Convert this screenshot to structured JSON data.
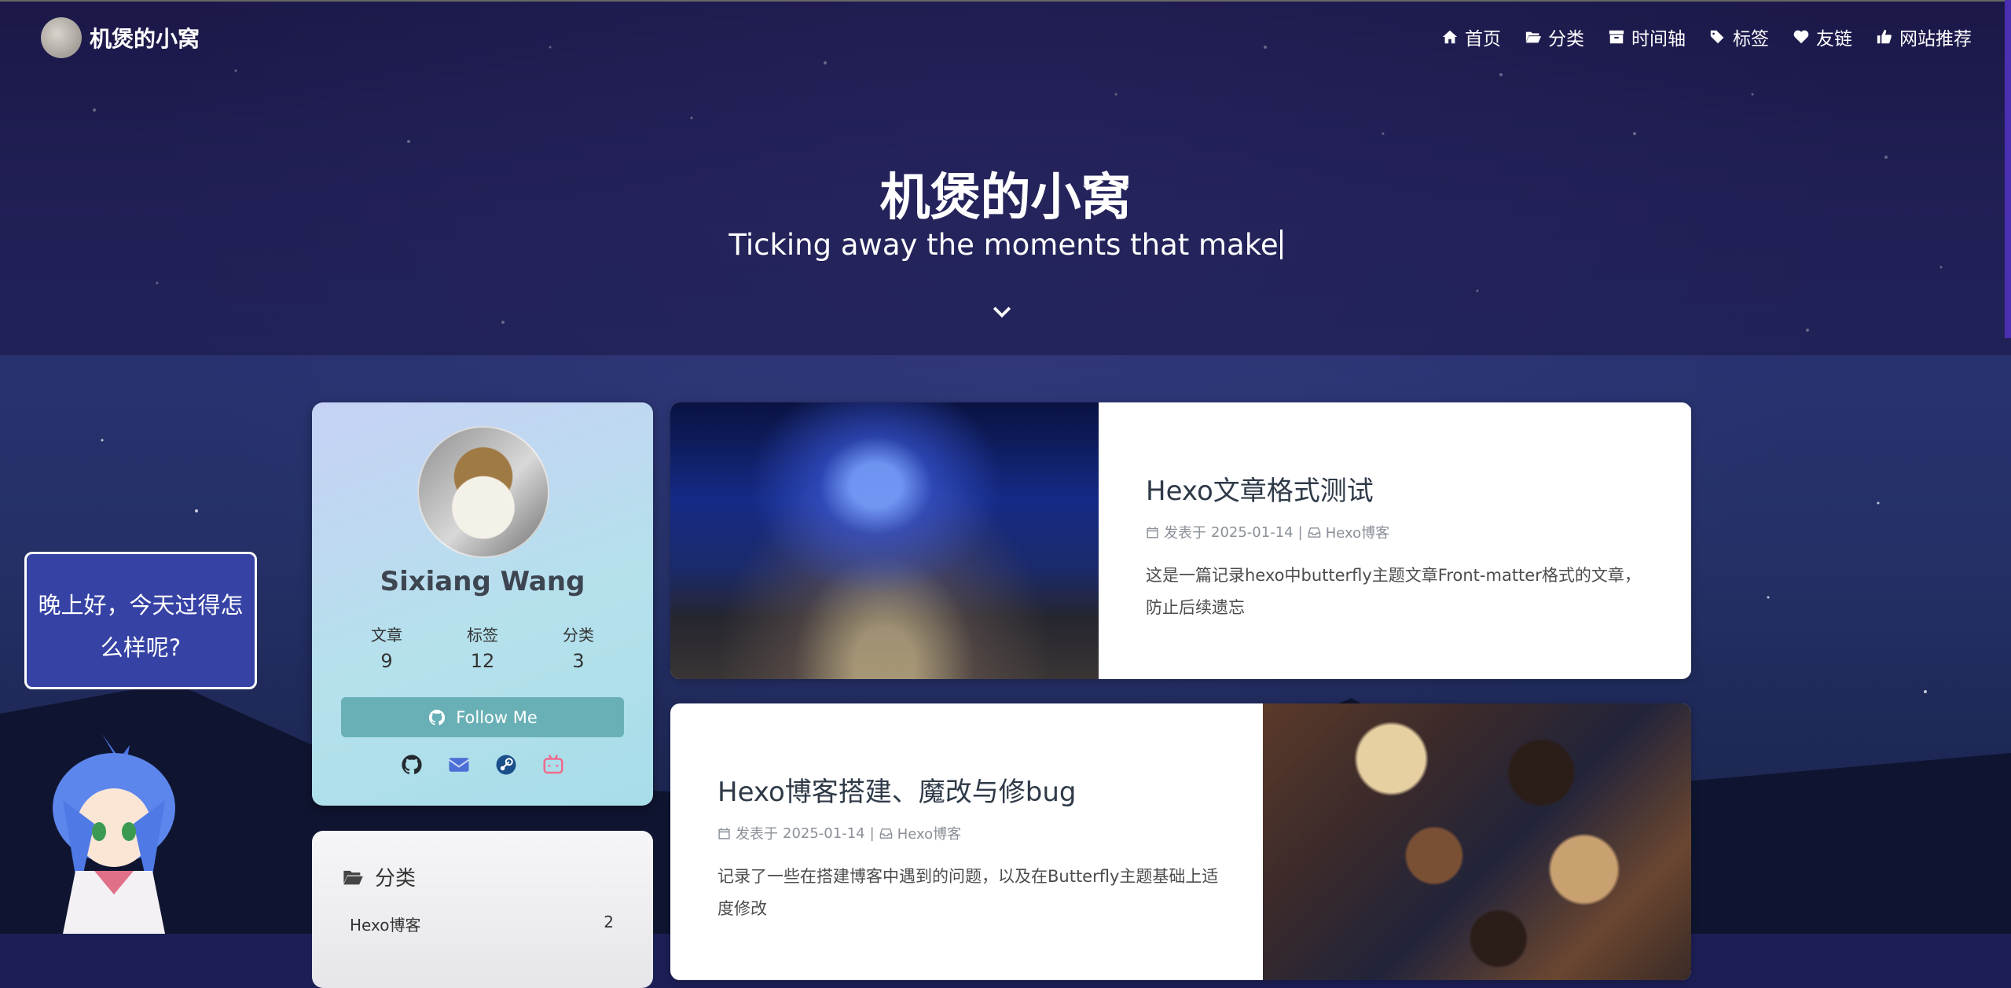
{
  "site": {
    "logo_text": "机煲的小窝",
    "title": "机煲的小窝",
    "subtitle": "Ticking away the moments that make"
  },
  "nav": [
    {
      "label": "首页",
      "icon": "home-icon"
    },
    {
      "label": "分类",
      "icon": "folder-open-icon"
    },
    {
      "label": "时间轴",
      "icon": "archive-icon"
    },
    {
      "label": "标签",
      "icon": "tags-icon"
    },
    {
      "label": "友链",
      "icon": "heart-icon"
    },
    {
      "label": "网站推荐",
      "icon": "thumbs-up-icon"
    }
  ],
  "profile": {
    "name": "Sixiang Wang",
    "stats": [
      {
        "label": "文章",
        "value": "9"
      },
      {
        "label": "标签",
        "value": "12"
      },
      {
        "label": "分类",
        "value": "3"
      }
    ],
    "follow_label": "Follow Me",
    "social": [
      "github-icon",
      "email-icon",
      "steam-icon",
      "bilibili-icon"
    ]
  },
  "categories": {
    "title": "分类",
    "items": [
      {
        "name": "Hexo博客",
        "count": "2"
      }
    ]
  },
  "greeting": "晚上好，今天过得怎么样呢?",
  "posts": [
    {
      "title": "Hexo文章格式测试",
      "date_prefix": "发表于",
      "date": "2025-01-14",
      "separator": "|",
      "category": "Hexo博客",
      "excerpt": "这是一篇记录hexo中butterfly主题文章Front-matter格式的文章，防止后续遗忘"
    },
    {
      "title": "Hexo博客搭建、魔改与修bug",
      "date_prefix": "发表于",
      "date": "2025-01-14",
      "separator": "|",
      "category": "Hexo博客",
      "excerpt": "记录了一些在搭建博客中遇到的问题，以及在Butterfly主题基础上适度修改"
    }
  ],
  "colors": {
    "accent": "#69b0b6",
    "greeting_bg": "#3642a4",
    "title_text": "#2f3a48"
  }
}
